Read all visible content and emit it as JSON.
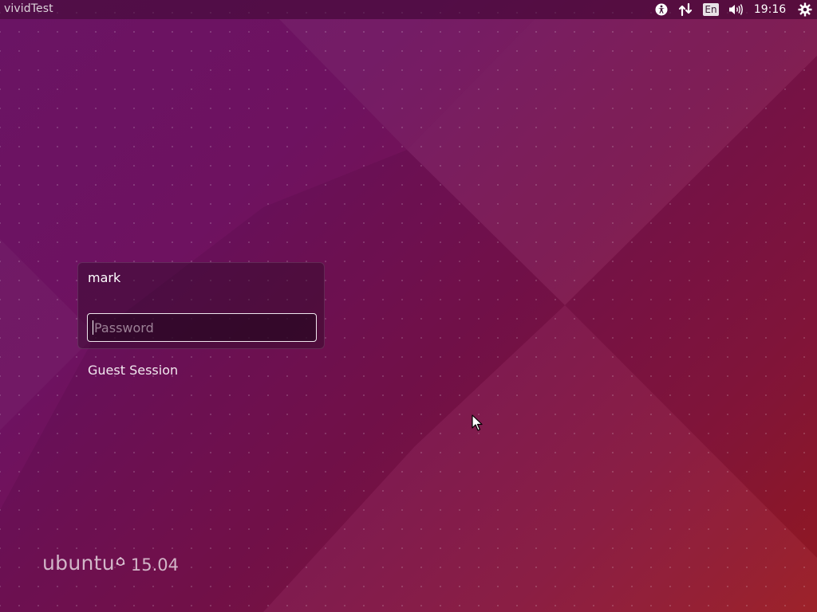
{
  "panel": {
    "host_name": "vividTest",
    "clock": "19:16",
    "language": "En",
    "icons": [
      "accessibility-icon",
      "network-icon",
      "keyboard-language-icon",
      "volume-icon",
      "power-gear-icon"
    ]
  },
  "login": {
    "user_name": "mark",
    "password_placeholder": "Password",
    "password_value": ""
  },
  "guest_session_label": "Guest Session",
  "branding": {
    "name": "ubuntu",
    "version": "15.04"
  },
  "colors": {
    "background_start": "#6a1464",
    "background_end": "#9a1a22",
    "panel": "#3c0a32",
    "text": "#ffffff"
  }
}
